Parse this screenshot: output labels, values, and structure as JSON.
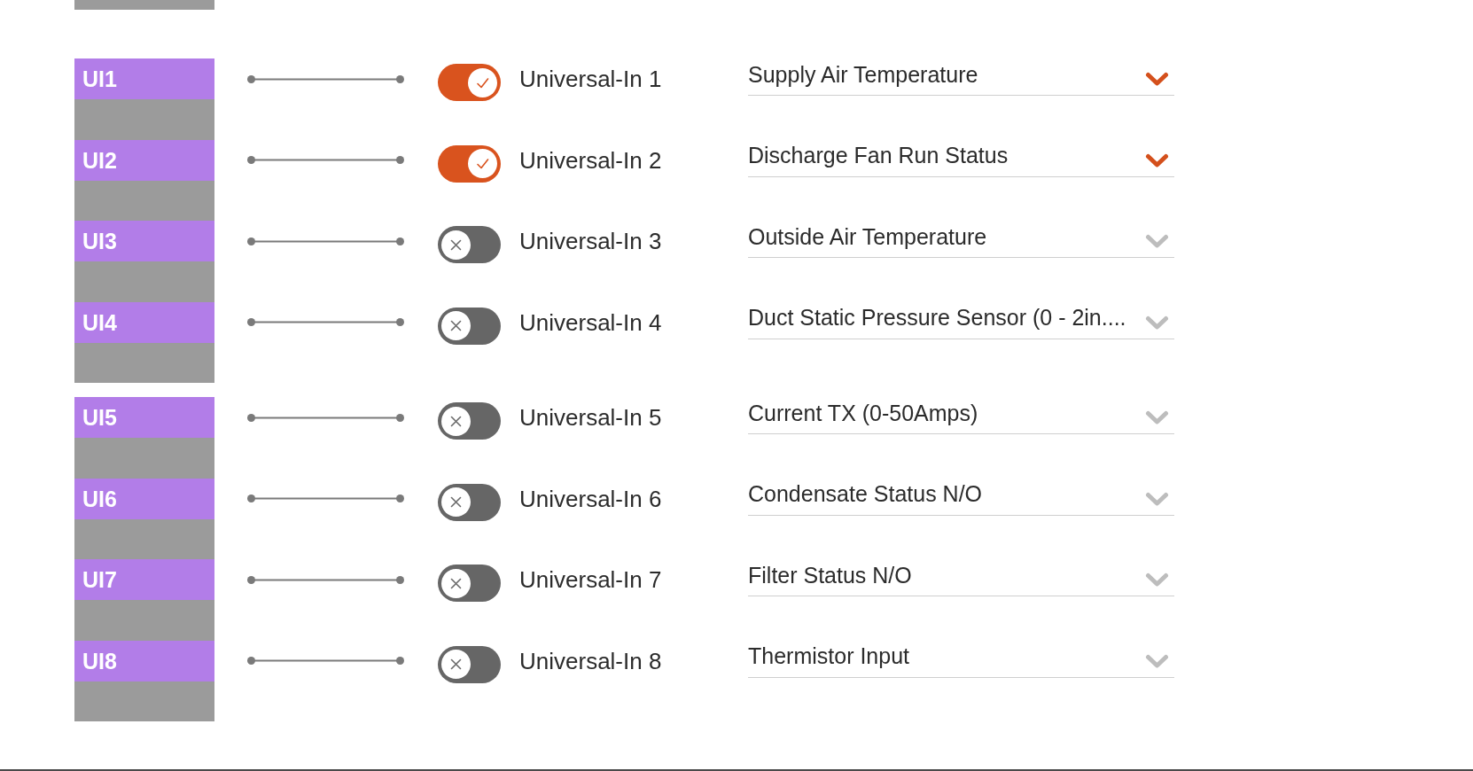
{
  "terminal_groups": [
    {
      "inputs": [
        {
          "terminal": "UI1",
          "enabled": true,
          "name": "Universal-In 1",
          "point_type": "Supply Air Temperature"
        },
        {
          "terminal": "UI2",
          "enabled": true,
          "name": "Universal-In 2",
          "point_type": "Discharge Fan Run Status"
        },
        {
          "terminal": "UI3",
          "enabled": false,
          "name": "Universal-In 3",
          "point_type": "Outside Air Temperature"
        },
        {
          "terminal": "UI4",
          "enabled": false,
          "name": "Universal-In 4",
          "point_type": "Duct Static Pressure Sensor (0 - 2in...."
        }
      ]
    },
    {
      "inputs": [
        {
          "terminal": "UI5",
          "enabled": false,
          "name": "Universal-In 5",
          "point_type": "Current TX (0-50Amps)"
        },
        {
          "terminal": "UI6",
          "enabled": false,
          "name": "Universal-In 6",
          "point_type": "Condensate Status N/O"
        },
        {
          "terminal": "UI7",
          "enabled": false,
          "name": "Universal-In 7",
          "point_type": "Filter Status N/O"
        },
        {
          "terminal": "UI8",
          "enabled": false,
          "name": "Universal-In 8",
          "point_type": "Thermistor Input"
        }
      ]
    }
  ]
}
